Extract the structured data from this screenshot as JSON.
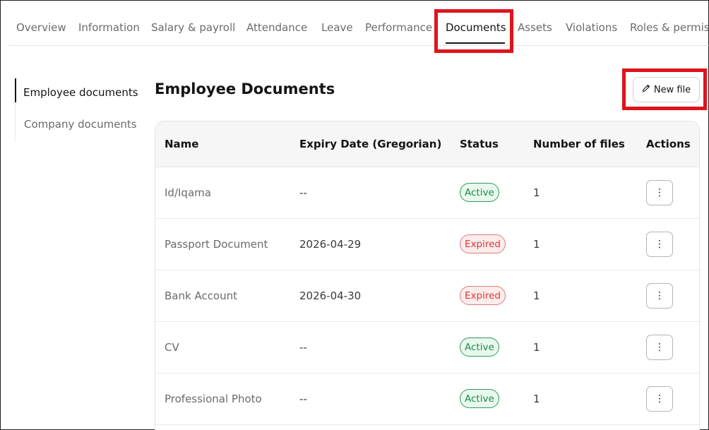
{
  "tabs": [
    {
      "label": "Overview",
      "active": false
    },
    {
      "label": "Information",
      "active": false
    },
    {
      "label": "Salary & payroll",
      "active": false
    },
    {
      "label": "Attendance",
      "active": false
    },
    {
      "label": "Leave",
      "active": false
    },
    {
      "label": "Performance",
      "active": false
    },
    {
      "label": "Documents",
      "active": true
    },
    {
      "label": "Assets",
      "active": false
    },
    {
      "label": "Violations",
      "active": false
    },
    {
      "label": "Roles & permis",
      "active": false
    }
  ],
  "sidebar": {
    "items": [
      {
        "label": "Employee documents",
        "active": true
      },
      {
        "label": "Company documents",
        "active": false
      }
    ]
  },
  "header": {
    "title": "Employee Documents",
    "new_file_label": "New file",
    "new_file_icon": "pencil-icon"
  },
  "table": {
    "columns": [
      "Name",
      "Expiry Date (Gregorian)",
      "Status",
      "Number of files",
      "Actions"
    ],
    "rows": [
      {
        "name": "Id/Iqama",
        "expiry": "--",
        "status": "Active",
        "files": "1",
        "actions_icon": "kebab-menu-icon"
      },
      {
        "name": "Passport Document",
        "expiry": "2026-04-29",
        "status": "Expired",
        "files": "1",
        "actions_icon": "kebab-menu-icon"
      },
      {
        "name": "Bank Account",
        "expiry": "2026-04-30",
        "status": "Expired",
        "files": "1",
        "actions_icon": "kebab-menu-icon"
      },
      {
        "name": "CV",
        "expiry": "--",
        "status": "Active",
        "files": "1",
        "actions_icon": "kebab-menu-icon"
      },
      {
        "name": "Professional Photo",
        "expiry": "--",
        "status": "Active",
        "files": "1",
        "actions_icon": "kebab-menu-icon"
      }
    ]
  },
  "colors": {
    "highlight": "#e0131b",
    "active_text": "#1e8a48",
    "active_bg": "#e9f8ee",
    "expired_text": "#d93a3a",
    "expired_bg": "#fdecec"
  }
}
